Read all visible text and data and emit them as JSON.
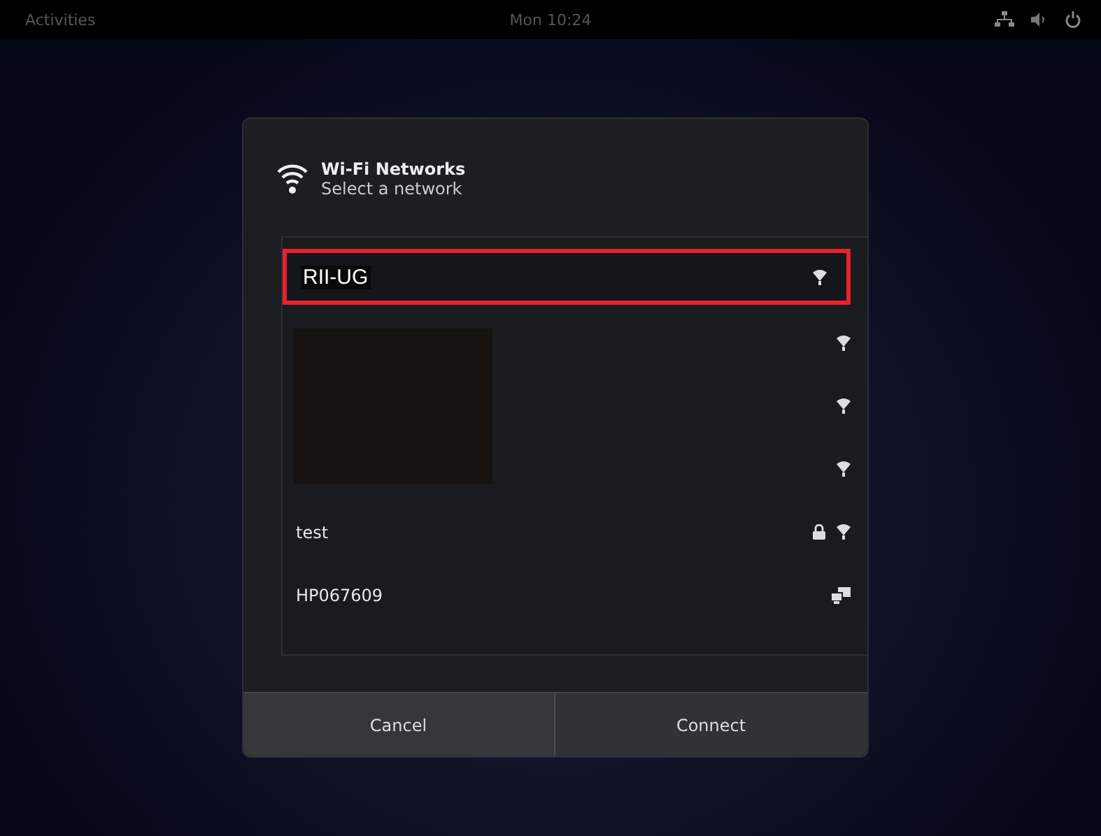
{
  "top_bar": {
    "activities": "Activities",
    "clock": "Mon 10:24"
  },
  "dialog": {
    "title": "Wi-Fi Networks",
    "subtitle": "Select a network",
    "networks": [
      {
        "name": "RII-UG",
        "highlighted": true,
        "secured": false,
        "kind": "wifi"
      },
      {
        "highlighted": false,
        "secured": false,
        "kind": "wifi",
        "redacted": true
      },
      {
        "highlighted": false,
        "secured": false,
        "kind": "wifi",
        "redacted": true
      },
      {
        "highlighted": false,
        "secured": false,
        "kind": "wifi",
        "redacted": true
      },
      {
        "name": "test",
        "highlighted": false,
        "secured": true,
        "kind": "wifi"
      },
      {
        "name": "HP067609",
        "highlighted": false,
        "secured": false,
        "kind": "adhoc"
      }
    ],
    "buttons": [
      {
        "label": "Cancel",
        "selected": false
      },
      {
        "label": "Connect",
        "selected": true
      }
    ]
  }
}
